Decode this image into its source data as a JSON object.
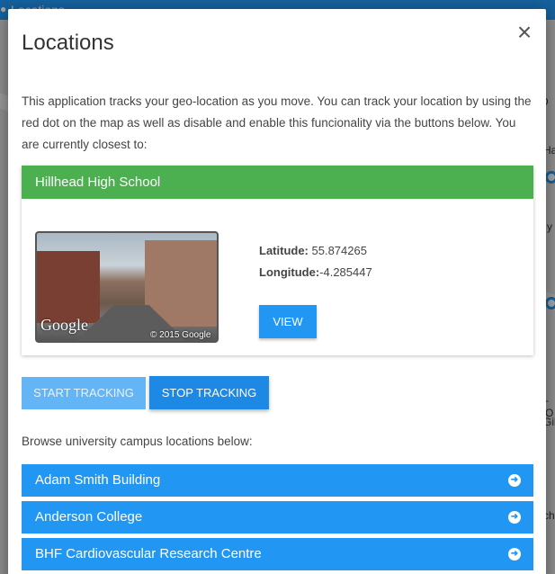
{
  "background": {
    "app_title": "Locations",
    "side_texts": [
      "n D",
      "Hanil",
      "y",
      "-O",
      "Gib",
      "cho"
    ]
  },
  "modal": {
    "title": "Locations",
    "close_label": "×",
    "intro": "This application tracks your geo-location as you move. You can track your location by using the red dot on the map as well as disable and enable this funcionality via the buttons below. You are currently closest to:",
    "card": {
      "name": "Hillhead High School",
      "image_google": "Google",
      "image_copyright": "© 2015 Google",
      "latitude_label": "Latitude:",
      "latitude_value": " 55.874265",
      "longitude_label": "Longitude:",
      "longitude_value": "-4.285447",
      "view_label": "VIEW"
    },
    "start_label": "START TRACKING",
    "stop_label": "STOP TRACKING",
    "browse_label": "Browse university campus locations below:",
    "campus_locations": [
      "Adam Smith Building",
      "Anderson College",
      "BHF Cardiovascular Research Centre"
    ]
  },
  "colors": {
    "primary": "#2196f3",
    "success_header": "#4caf50",
    "start_disabled": "#64b5f6"
  }
}
